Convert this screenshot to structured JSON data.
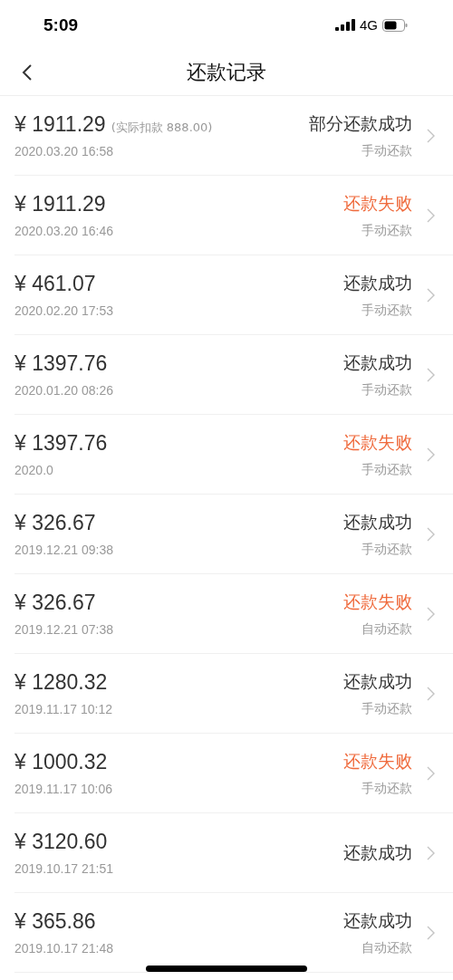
{
  "status_bar": {
    "time": "5:09",
    "network": "4G"
  },
  "nav": {
    "title": "还款记录"
  },
  "records": [
    {
      "amount": "¥ 1911.29",
      "note": "(实际扣款 888.00)",
      "date": "2020.03.20 16:58",
      "status": "部分还款成功",
      "failed": false,
      "method": "手动还款"
    },
    {
      "amount": "¥ 1911.29",
      "date": "2020.03.20 16:46",
      "status": "还款失败",
      "failed": true,
      "method": "手动还款"
    },
    {
      "amount": "¥ 461.07",
      "date": "2020.02.20 17:53",
      "status": "还款成功",
      "failed": false,
      "method": "手动还款"
    },
    {
      "amount": "¥ 1397.76",
      "date": "2020.01.20 08:26",
      "status": "还款成功",
      "failed": false,
      "method": "手动还款"
    },
    {
      "amount": "¥ 1397.76",
      "date": "2020.0",
      "status": "还款失败",
      "failed": true,
      "method": "手动还款"
    },
    {
      "amount": "¥ 326.67",
      "date": "2019.12.21 09:38",
      "status": "还款成功",
      "failed": false,
      "method": "手动还款"
    },
    {
      "amount": "¥ 326.67",
      "date": "2019.12.21 07:38",
      "status": "还款失败",
      "failed": true,
      "method": "自动还款"
    },
    {
      "amount": "¥ 1280.32",
      "date": "2019.11.17 10:12",
      "status": "还款成功",
      "failed": false,
      "method": "手动还款"
    },
    {
      "amount": "¥ 1000.32",
      "date": "2019.11.17 10:06",
      "status": "还款失败",
      "failed": true,
      "method": "手动还款"
    },
    {
      "amount": "¥ 3120.60",
      "date": "2019.10.17 21:51",
      "status": "还款成功",
      "failed": false
    },
    {
      "amount": "¥ 365.86",
      "date": "2019.10.17 21:48",
      "status": "还款成功",
      "failed": false,
      "method": "自动还款"
    }
  ]
}
